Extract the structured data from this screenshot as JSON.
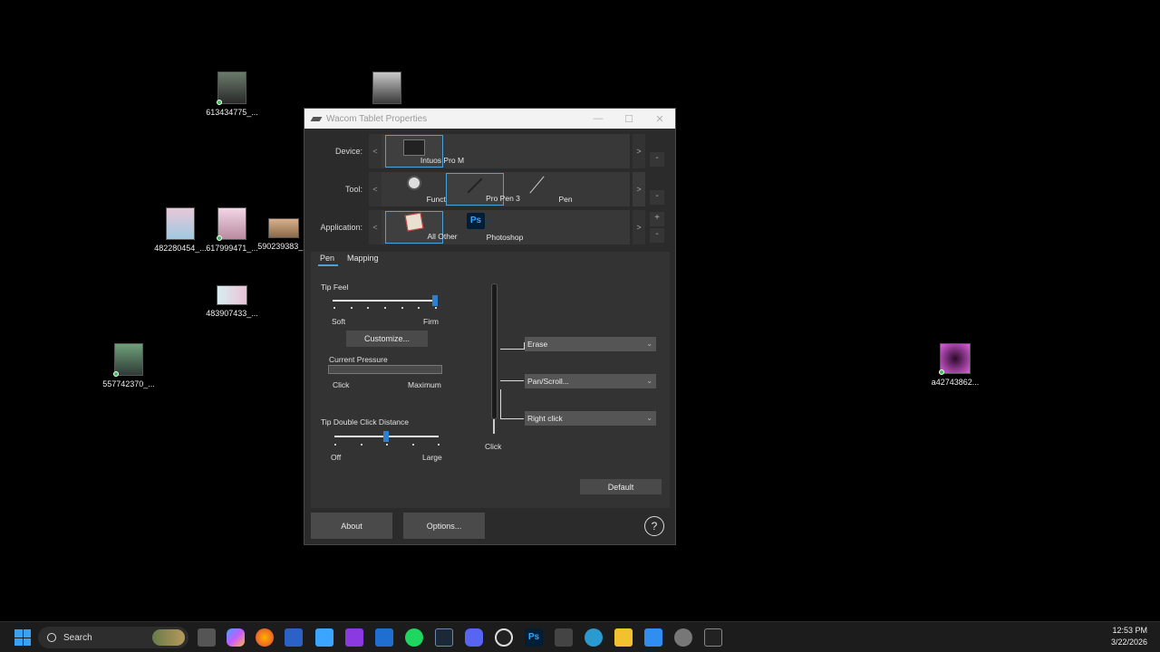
{
  "desktop": {
    "icons": [
      {
        "label": "613434775_..."
      },
      {
        "label": ""
      },
      {
        "label": "482280454_..."
      },
      {
        "label": "617999471_..."
      },
      {
        "label": "590239383_..."
      },
      {
        "label": "483907433_..."
      },
      {
        "label": "557742370_..."
      },
      {
        "label": "a42743862..."
      }
    ]
  },
  "window": {
    "title": "Wacom Tablet Properties",
    "minimize": "—",
    "maximize": "☐",
    "close": "✕"
  },
  "device": {
    "label": "Device:",
    "items": [
      {
        "name": "Intuos Pro M"
      }
    ]
  },
  "tool": {
    "label": "Tool:",
    "items": [
      {
        "name": "Functions"
      },
      {
        "name": "Pro Pen 3"
      },
      {
        "name": "Pen"
      }
    ]
  },
  "application": {
    "label": "Application:",
    "items": [
      {
        "name": "All Other"
      },
      {
        "name": "Photoshop",
        "badge": "Ps"
      }
    ],
    "add": "+",
    "remove": "-"
  },
  "arrows": {
    "left": "<",
    "right": ">"
  },
  "tabs": [
    {
      "label": "Pen"
    },
    {
      "label": "Mapping"
    }
  ],
  "pen": {
    "tip_feel": {
      "label": "Tip Feel",
      "soft": "Soft",
      "firm": "Firm",
      "value": 1.0
    },
    "customize": "Customize...",
    "current_pressure": {
      "label": "Current Pressure",
      "min": "Click",
      "max": "Maximum",
      "value": 0
    },
    "double_click": {
      "label": "Tip Double Click Distance",
      "off": "Off",
      "large": "Large",
      "value": 0.5
    },
    "buttons": {
      "top": "Erase",
      "upper": "Pan/Scroll...",
      "lower": "Right click",
      "tip": "Click"
    },
    "default": "Default"
  },
  "footer": {
    "about": "About",
    "options": "Options...",
    "help": "?"
  },
  "taskbar": {
    "search_placeholder": "Search",
    "time": "12:53 PM",
    "date": "3/22/2026"
  }
}
